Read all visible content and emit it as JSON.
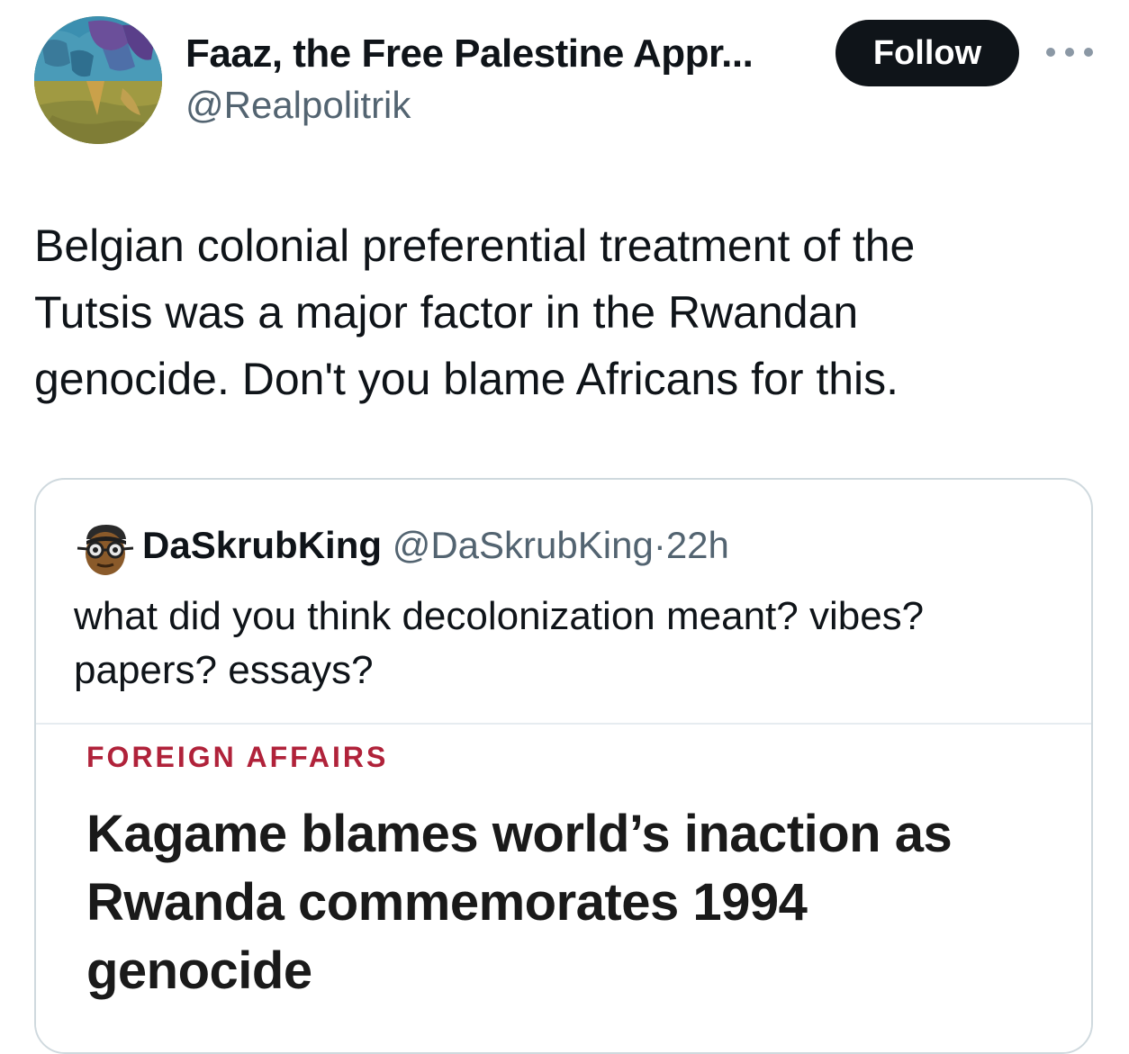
{
  "tweet": {
    "author": {
      "display_name": "Faaz, the Free Palestine Appr...",
      "handle": "@Realpolitrik"
    },
    "follow_label": "Follow",
    "more_icon": "more-horizontal-icon",
    "text": "Belgian colonial preferential treatment of the\nTutsis was a major factor in the Rwandan\ngenocide. Don't you blame Africans for this."
  },
  "quote": {
    "author": {
      "display_name": "DaSkrubKing",
      "handle": "@DaSkrubKing",
      "separator": "·",
      "time": "22h"
    },
    "text": "what did you think decolonization meant? vibes?\npapers? essays?",
    "media": {
      "source": "FOREIGN AFFAIRS",
      "headline": "Kagame blames world’s inaction as\nRwanda commemorates 1994\ngenocide"
    }
  },
  "colors": {
    "follow_bg": "#0f1419",
    "secondary_text": "#536471",
    "source_label": "#b0223a",
    "card_border": "#cfd9de"
  }
}
